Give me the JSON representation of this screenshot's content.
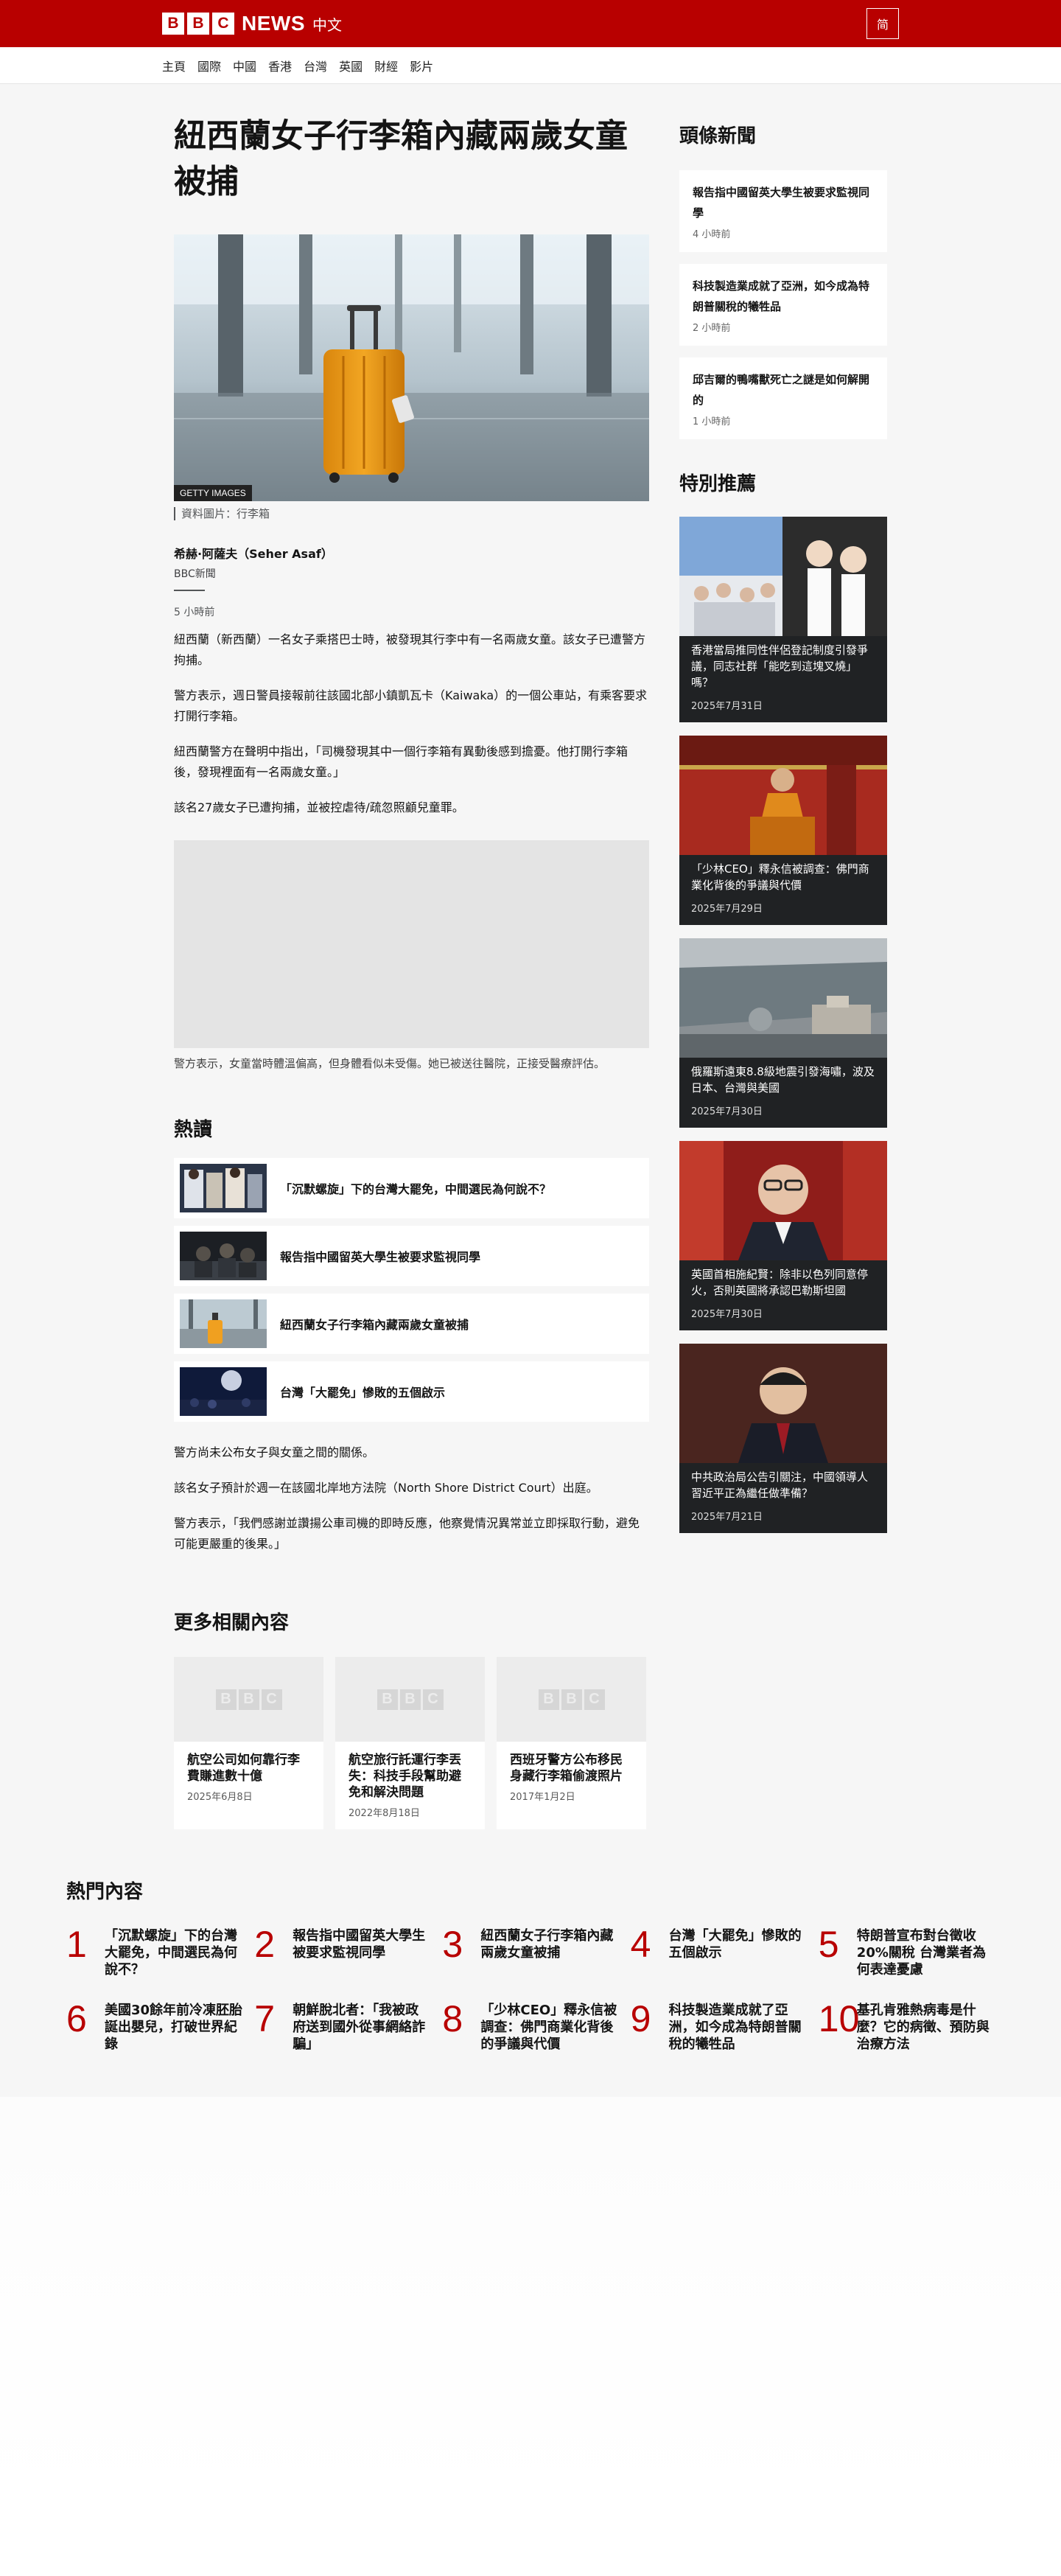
{
  "header": {
    "brand_letters": [
      "B",
      "B",
      "C"
    ],
    "brand_name": "NEWS",
    "brand_lang": "中文",
    "script_toggle": "简"
  },
  "nav": {
    "items": [
      "主頁",
      "國際",
      "中國",
      "香港",
      "台灣",
      "英國",
      "財經",
      "影片"
    ]
  },
  "article": {
    "headline": "紐西蘭女子行李箱內藏兩歲女童被捕",
    "image_credit": "GETTY IMAGES",
    "image_caption": "資料圖片：行李箱",
    "author": "希赫·阿薩夫（Seher Asaf）",
    "author_org": "BBC新聞",
    "timestamp": "5 小時前",
    "paragraphs": [
      "紐西蘭（新西蘭）一名女子乘搭巴士時，被發現其行李中有一名兩歲女童。該女子已遭警方拘捕。",
      "警方表示，週日警員接報前往該國北部小鎮凱瓦卡（Kaiwaka）的一個公車站，有乘客要求打開行李箱。",
      "紐西蘭警方在聲明中指出，「司機發現其中一個行李箱有異動後感到擔憂。他打開行李箱後，發現裡面有一名兩歲女童。」",
      "該名27歲女子已遭拘捕，並被控虐待/疏忽照顧兒童罪。"
    ],
    "media_caption": "警方表示，女童當時體溫偏高，但身體看似未受傷。她已被送往醫院，正接受醫療評估。",
    "more_paragraphs": [
      "警方尚未公布女子與女童之間的關係。",
      "該名女子預計於週一在該國北岸地方法院（North Shore District Court）出庭。",
      "警方表示，「我們感謝並讚揚公車司機的即時反應，他察覺情況異常並立即採取行動，避免可能更嚴重的後果。」"
    ]
  },
  "hot_reads": {
    "title": "熱讀",
    "items": [
      "「沉默螺旋」下的台灣大罷免，中間選民為何說不？",
      "報告指中國留英大學生被要求監視同學",
      "紐西蘭女子行李箱內藏兩歲女童被捕",
      "台灣「大罷免」慘敗的五個啟示"
    ]
  },
  "related": {
    "title": "更多相關內容",
    "cards": [
      {
        "title": "航空公司如何靠行李費賺進數十億",
        "date": "2025年6月8日"
      },
      {
        "title": "航空旅行託運行李丟失：科技手段幫助避免和解決問題",
        "date": "2022年8月18日"
      },
      {
        "title": "西班牙警方公布移民身藏行李箱偷渡照片",
        "date": "2017年1月2日"
      }
    ]
  },
  "sidebar": {
    "top_title": "頭條新聞",
    "top_stories": [
      {
        "title": "報告指中國留英大學生被要求監視同學",
        "time": "4 小時前"
      },
      {
        "title": "科技製造業成就了亞洲，如今成為特朗普關稅的犧牲品",
        "time": "2 小時前"
      },
      {
        "title": "邱吉爾的鴨嘴獸死亡之謎是如何解開的",
        "time": "1 小時前"
      }
    ],
    "feature_title": "特別推薦",
    "features": [
      {
        "title": "香港當局推同性伴侶登記制度引發爭議，同志社群「能吃到這塊叉燒」嗎？",
        "date": "2025年7月31日"
      },
      {
        "title": "「少林CEO」釋永信被調查：佛門商業化背後的爭議與代價",
        "date": "2025年7月29日"
      },
      {
        "title": "俄羅斯遠東8.8級地震引發海嘯，波及日本、台灣與美國",
        "date": "2025年7月30日"
      },
      {
        "title": "英國首相施紀賢：除非以色列同意停火，否則英國將承認巴勒斯坦國",
        "date": "2025年7月30日"
      },
      {
        "title": "中共政治局公告引關注，中國領導人習近平正為繼任做準備？",
        "date": "2025年7月21日"
      }
    ]
  },
  "popular": {
    "title": "熱門內容",
    "items": [
      {
        "rank": "1",
        "title": "「沉默螺旋」下的台灣大罷免，中間選民為何說不？"
      },
      {
        "rank": "2",
        "title": "報告指中國留英大學生被要求監視同學"
      },
      {
        "rank": "3",
        "title": "紐西蘭女子行李箱內藏兩歲女童被捕"
      },
      {
        "rank": "4",
        "title": "台灣「大罷免」慘敗的五個啟示"
      },
      {
        "rank": "5",
        "title": "特朗普宣布對台徵收20%關稅 台灣業者為何表達憂慮"
      },
      {
        "rank": "6",
        "title": "美國30餘年前冷凍胚胎誕出嬰兒，打破世界紀錄"
      },
      {
        "rank": "7",
        "title": "朝鮮脫北者：「我被政府送到國外從事網絡詐騙」"
      },
      {
        "rank": "8",
        "title": "「少林CEO」釋永信被調查：佛門商業化背後的爭議與代價"
      },
      {
        "rank": "9",
        "title": "科技製造業成就了亞洲，如今成為特朗普關稅的犧牲品"
      },
      {
        "rank": "10",
        "title": "基孔肯雅熱病毒是什麼？它的病徵、預防與治療方法"
      }
    ]
  }
}
